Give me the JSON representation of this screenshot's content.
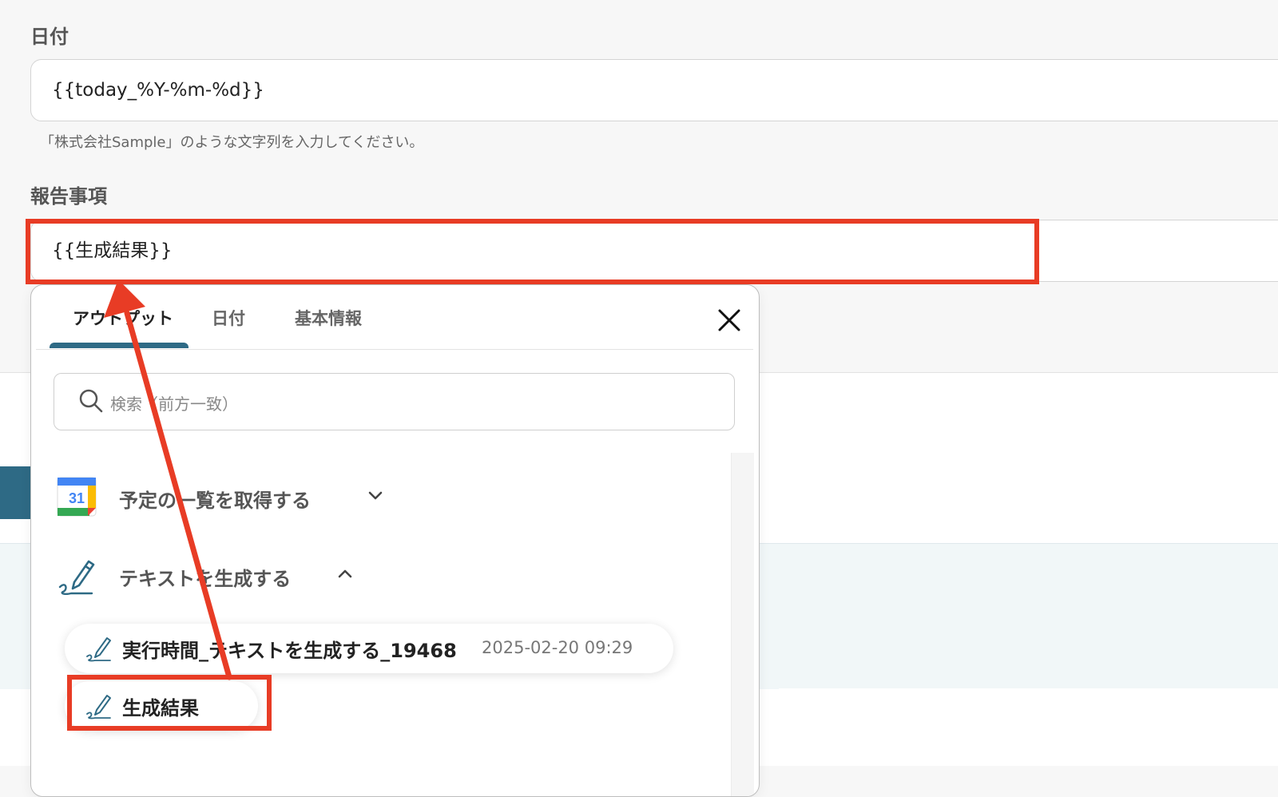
{
  "form": {
    "date_label": "日付",
    "date_value": "{{today_%Y-%m-%d}}",
    "hint": "「株式会社Sample」のような文字列を入力してください。",
    "report_label": "報告事項",
    "report_value": "{{生成結果}}"
  },
  "popup": {
    "tabs": [
      {
        "label": "アウトプット",
        "active": true
      },
      {
        "label": "日付",
        "active": false
      },
      {
        "label": "基本情報",
        "active": false
      }
    ],
    "search_placeholder": "検索（前方一致）",
    "groups": [
      {
        "label": "予定の一覧を取得する",
        "icon": "google-calendar-icon",
        "expanded": false,
        "calendar_day": "31"
      },
      {
        "label": "テキストを生成する",
        "icon": "pen-icon",
        "expanded": true
      }
    ],
    "items": [
      {
        "label": "実行時間_テキストを生成する_19468",
        "value": "2025-02-20 09:29",
        "icon": "pen-icon"
      },
      {
        "label": "生成結果",
        "icon": "pen-icon"
      }
    ]
  },
  "colors": {
    "highlight": "#e83c25",
    "accent": "#2e6a85",
    "background": "#f7f7f7"
  }
}
